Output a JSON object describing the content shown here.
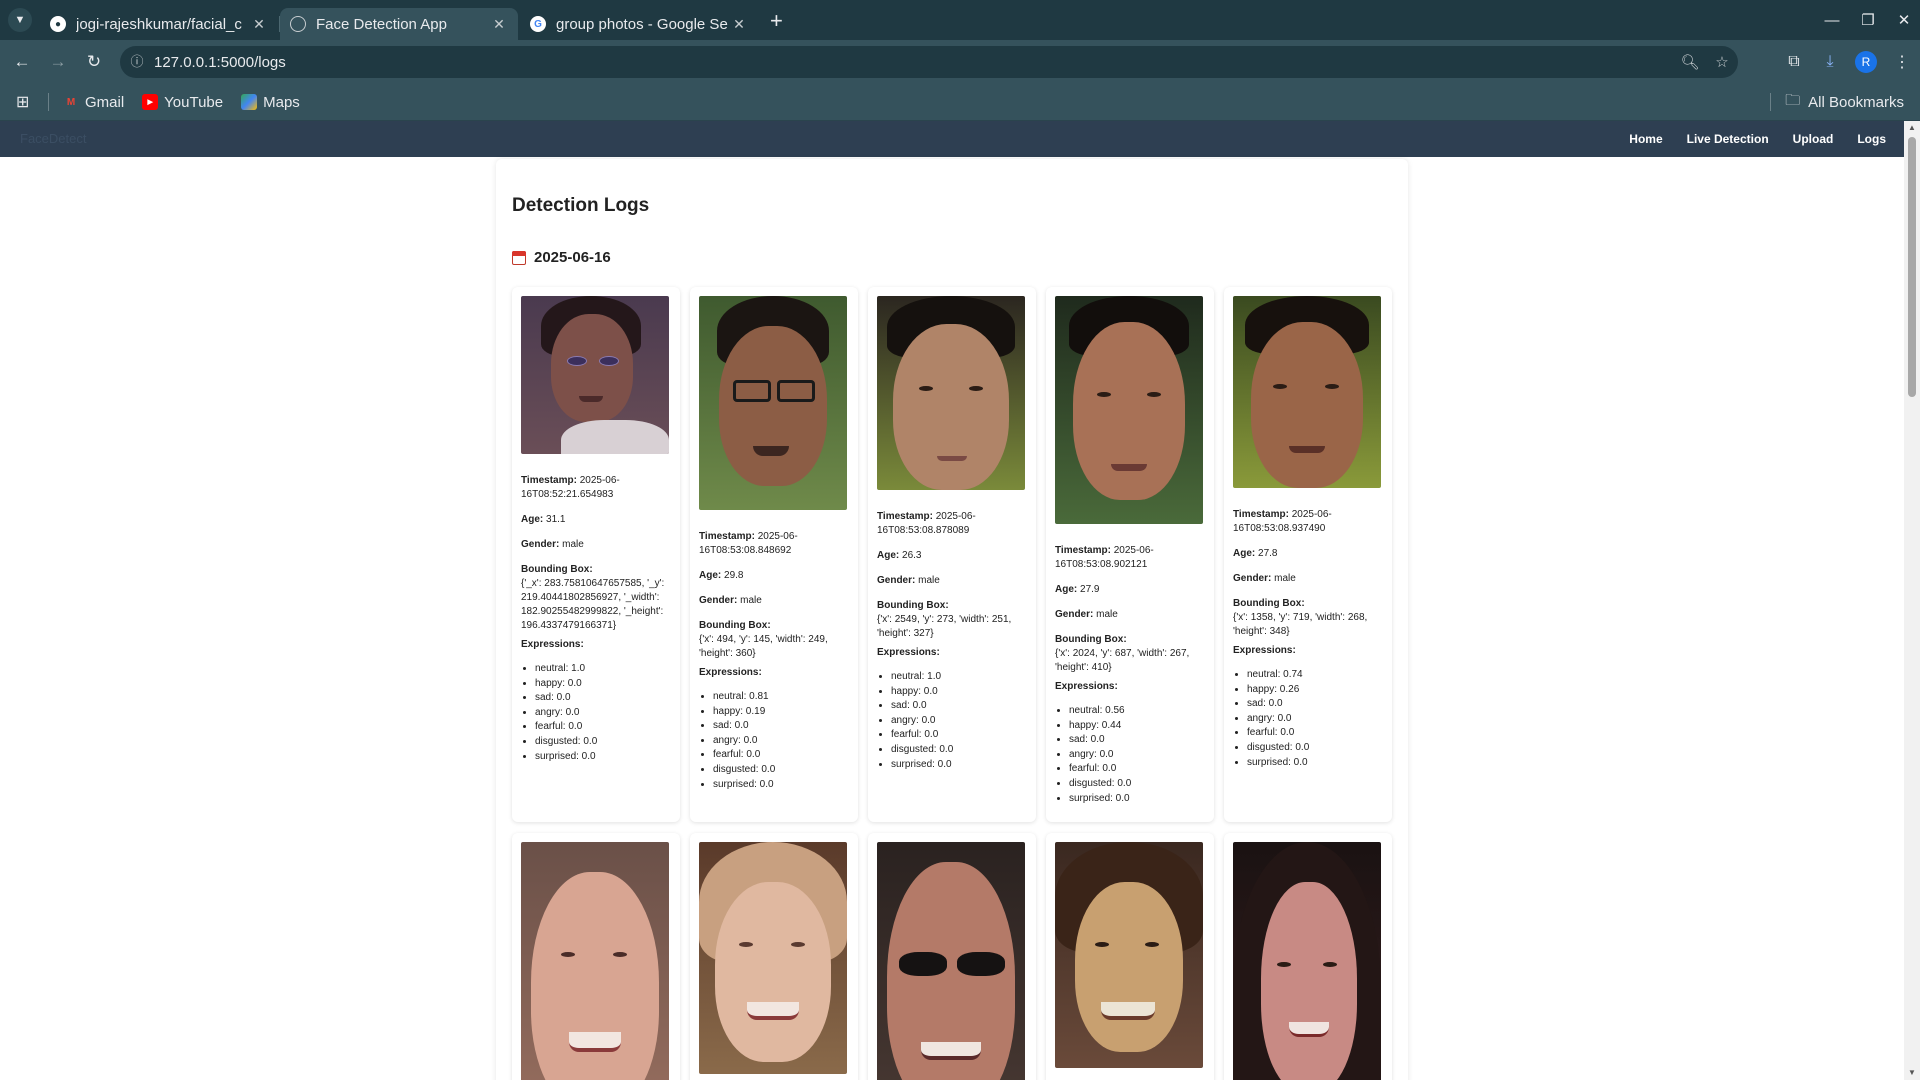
{
  "browser": {
    "tabs": [
      {
        "title": "jogi-rajeshkumar/facial_c",
        "favicon": "github-icon",
        "active": false
      },
      {
        "title": "Face Detection App",
        "favicon": "globe-icon",
        "active": true
      },
      {
        "title": "group photos - Google Se",
        "favicon": "google-icon",
        "active": false
      }
    ],
    "url": "127.0.0.1:5000/logs",
    "profile_initial": "R",
    "bookmarks": [
      {
        "label": "Gmail",
        "icon": "gmail-icon"
      },
      {
        "label": "YouTube",
        "icon": "youtube-icon"
      },
      {
        "label": "Maps",
        "icon": "maps-icon"
      }
    ],
    "all_bookmarks": "All Bookmarks"
  },
  "app": {
    "brand": "FaceDetect",
    "nav": [
      "Home",
      "Live Detection",
      "Upload",
      "Logs"
    ],
    "page_title": "Detection Logs",
    "date": "2025-06-16"
  },
  "labels": {
    "timestamp": "Timestamp:",
    "age": "Age:",
    "gender": "Gender:",
    "bbox": "Bounding Box:",
    "expressions": "Expressions:"
  },
  "logs": [
    {
      "timestamp": "2025-06-16T08:52:21.654983",
      "age": "31.1",
      "gender": "male",
      "bbox": "{'_x': 283.75810647657585, '_y': 219.40441802856927, '_width': 182.90255482999822, '_height': 196.4337479166371}",
      "expressions": [
        "neutral: 1.0",
        "happy: 0.0",
        "sad: 0.0",
        "angry: 0.0",
        "fearful: 0.0",
        "disgusted: 0.0",
        "surprised: 0.0"
      ]
    },
    {
      "timestamp": "2025-06-16T08:53:08.848692",
      "age": "29.8",
      "gender": "male",
      "bbox": "{'x': 494, 'y': 145, 'width': 249, 'height': 360}",
      "expressions": [
        "neutral: 0.81",
        "happy: 0.19",
        "sad: 0.0",
        "angry: 0.0",
        "fearful: 0.0",
        "disgusted: 0.0",
        "surprised: 0.0"
      ]
    },
    {
      "timestamp": "2025-06-16T08:53:08.878089",
      "age": "26.3",
      "gender": "male",
      "bbox": "{'x': 2549, 'y': 273, 'width': 251, 'height': 327}",
      "expressions": [
        "neutral: 1.0",
        "happy: 0.0",
        "sad: 0.0",
        "angry: 0.0",
        "fearful: 0.0",
        "disgusted: 0.0",
        "surprised: 0.0"
      ]
    },
    {
      "timestamp": "2025-06-16T08:53:08.902121",
      "age": "27.9",
      "gender": "male",
      "bbox": "{'x': 2024, 'y': 687, 'width': 267, 'height': 410}",
      "expressions": [
        "neutral: 0.56",
        "happy: 0.44",
        "sad: 0.0",
        "angry: 0.0",
        "fearful: 0.0",
        "disgusted: 0.0",
        "surprised: 0.0"
      ]
    },
    {
      "timestamp": "2025-06-16T08:53:08.937490",
      "age": "27.8",
      "gender": "male",
      "bbox": "{'x': 1358, 'y': 719, 'width': 268, 'height': 348}",
      "expressions": [
        "neutral: 0.74",
        "happy: 0.26",
        "sad: 0.0",
        "angry: 0.0",
        "fearful: 0.0",
        "disgusted: 0.0",
        "surprised: 0.0"
      ]
    }
  ],
  "colors": {
    "chrome_dark": "#1f3942",
    "chrome_toolbar": "#35525c",
    "app_nav": "#2e3f52"
  }
}
